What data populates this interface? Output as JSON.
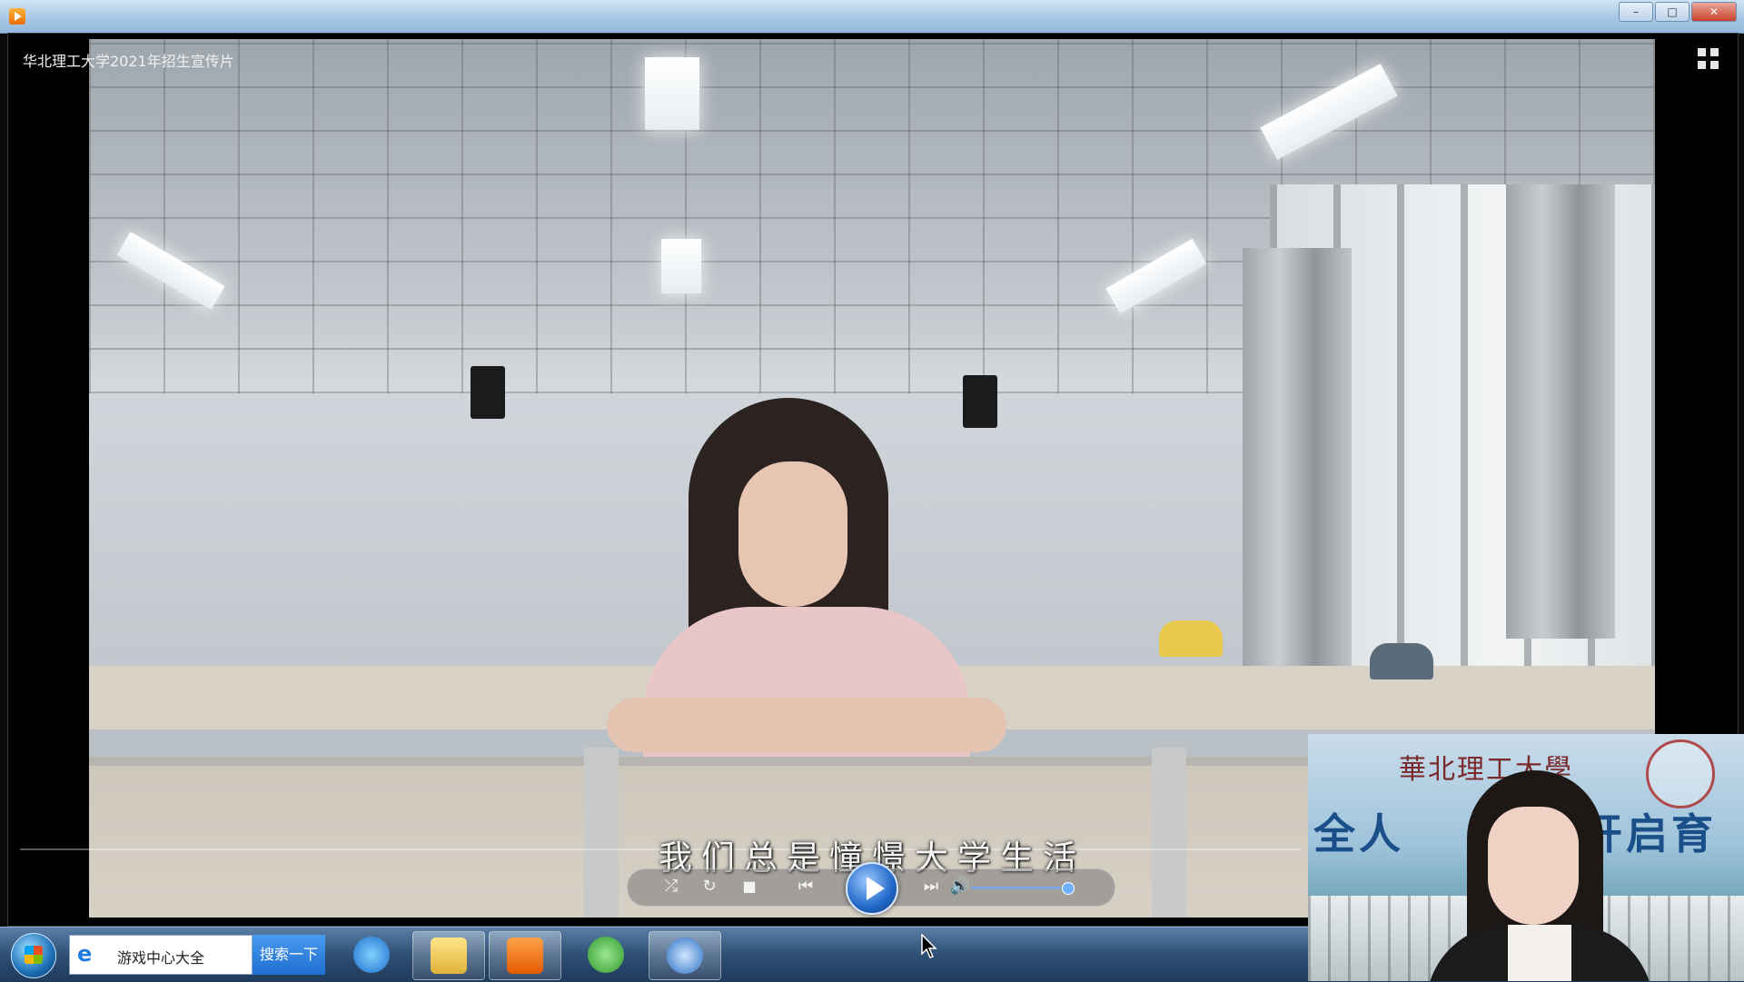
{
  "window": {
    "controls": {
      "minimize": "–",
      "maximize": "□",
      "close": "✕"
    }
  },
  "player": {
    "video_title": "华北理工大学2021年招生宣传片",
    "subtitle": "我们总是憧憬大学生活",
    "controls": {
      "shuffle_icon": "⤮",
      "repeat_icon": "↻",
      "stop_icon": "■",
      "prev_icon": "⏮",
      "next_icon": "⏭",
      "volume_icon": "🔊"
    },
    "icons": [
      "app-logo-icon",
      "fullscreen-toggle-icon",
      "play-icon",
      "start-orb-icon",
      "ie-icon",
      "folder-icon",
      "media-player-icon",
      "refresh-icon",
      "ie-alt-icon"
    ]
  },
  "taskbar": {
    "search_text": "游戏中心大全",
    "search_button": "搜索一下"
  },
  "webcam": {
    "banner_left": "全人",
    "banner_right": "开启育"
  },
  "colors": {
    "titlebar": "#a9c8e6",
    "taskbar": "#2f4f74",
    "play_button": "#2068c8",
    "search_button": "#1d6fd0"
  }
}
